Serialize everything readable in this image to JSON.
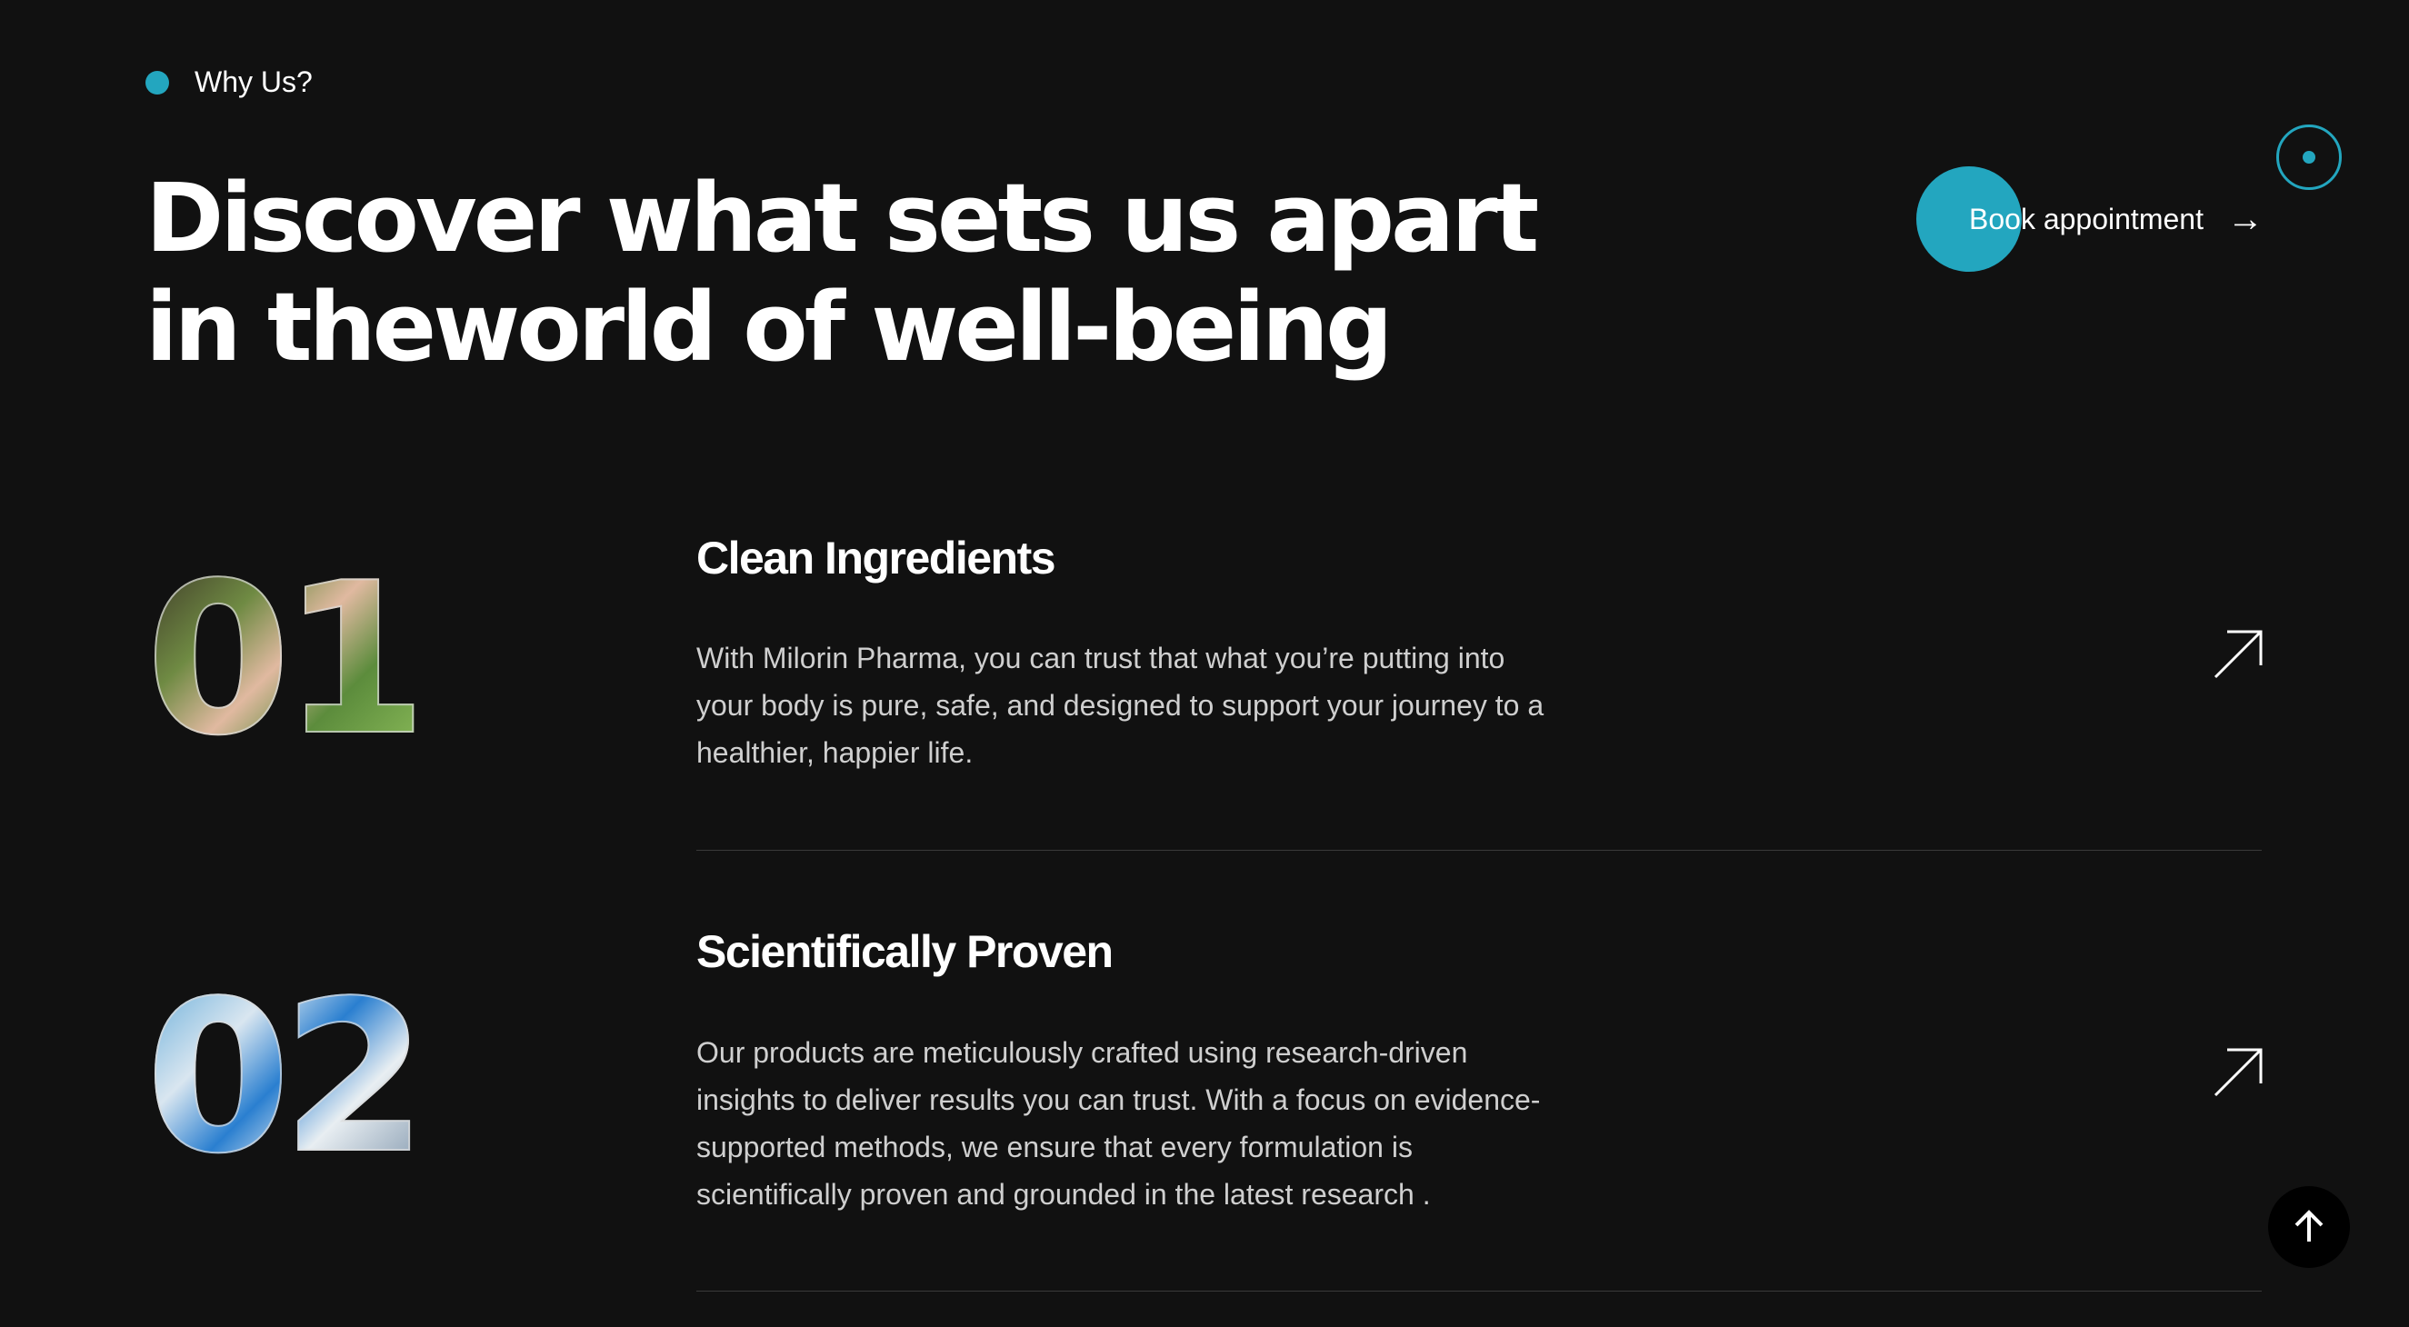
{
  "section": {
    "eyebrow": "Why Us?",
    "heading_line1": "Discover what sets us apart",
    "heading_line2": "in theworld of well-being",
    "cta_label": "Book appointment",
    "accent_color": "#23a6bf"
  },
  "features": [
    {
      "number": "01",
      "title": "Clean Ingredients",
      "body": "With Milorin Pharma, you can trust that what you’re putting into your body is pure, safe, and designed to support your journey to a healthier, happier life.",
      "icon": "arrow-up-right-icon"
    },
    {
      "number": "02",
      "title": "Scientifically Proven",
      "body": "Our products are meticulously crafted using research-driven insights to deliver results you can trust. With a focus on evidence-supported methods, we ensure that every formulation is scientifically proven and grounded in the latest research .",
      "icon": "arrow-up-right-icon"
    }
  ],
  "icons": {
    "cta": "arrow-right-icon",
    "scroll_top": "arrow-up-icon",
    "cursor": "cursor-ring-icon"
  }
}
